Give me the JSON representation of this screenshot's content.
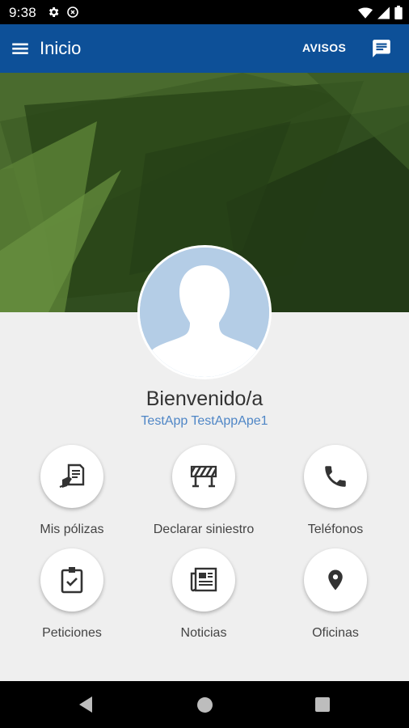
{
  "status_bar": {
    "time": "9:38",
    "left_icons": [
      "settings-icon",
      "data-saver-icon"
    ],
    "right_icons": [
      "wifi-icon",
      "signal-icon",
      "battery-icon"
    ]
  },
  "app_bar": {
    "title": "Inicio",
    "avisos_label": "AVISOS",
    "color": "#0d5098"
  },
  "profile": {
    "welcome": "Bienvenido/a",
    "username": "TestApp TestAppApe1"
  },
  "tiles": [
    {
      "label": "Mis pólizas",
      "icon": "policy-document-icon"
    },
    {
      "label": "Declarar siniestro",
      "icon": "road-barrier-icon"
    },
    {
      "label": "Teléfonos",
      "icon": "phone-icon"
    },
    {
      "label": "Peticiones",
      "icon": "clipboard-check-icon"
    },
    {
      "label": "Noticias",
      "icon": "newspaper-icon"
    },
    {
      "label": "Oficinas",
      "icon": "location-pin-icon"
    }
  ],
  "nav_bar": {
    "icons": [
      "back-icon",
      "home-icon",
      "recents-icon"
    ]
  }
}
